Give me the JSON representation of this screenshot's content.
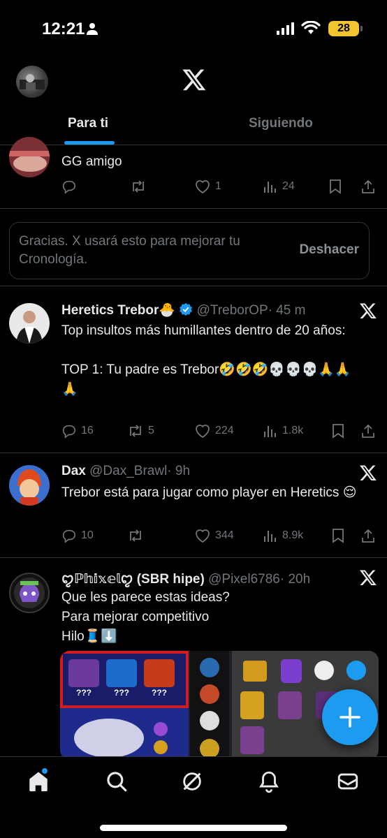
{
  "status_bar": {
    "time": "12:21",
    "battery": "28"
  },
  "header": {
    "logo": "x-logo",
    "tabs": [
      {
        "label": "Para ti",
        "active": true
      },
      {
        "label": "Siguiendo",
        "active": false
      }
    ]
  },
  "feed": {
    "reply_post": {
      "text": "GG amigo",
      "likes": "1",
      "views": "24"
    },
    "feedback": {
      "message": "Gracias. X usará esto para mejorar tu Cronología.",
      "undo_label": "Deshacer"
    },
    "posts": [
      {
        "name": "Heretics Trebor🐣",
        "handle": "@TreborOP",
        "time": "· 45 m",
        "text": "Top insultos más humillantes dentro de 20 años:\n\nTOP 1: Tu padre es Trebor🤣🤣🤣💀💀💀🙏🙏🙏",
        "replies": "16",
        "reposts": "5",
        "likes": "224",
        "views": "1.8k"
      },
      {
        "name": "Dax",
        "handle": "@Dax_Brawl",
        "time": "· 9h",
        "text": "Trebor está para jugar como player en Heretics 😌",
        "replies": "10",
        "reposts": "",
        "likes": "344",
        "views": "8.9k"
      },
      {
        "name": "ꨄ︎ℙ𝕙𝕚𝕩𝕖𝕝ꨄ︎ (SBR hipe)",
        "handle": "@Pixel6786",
        "time": "· 20h",
        "text": "Que les parece estas ideas?\nPara mejorar competitivo\nHilo🧵⬇️",
        "media_labels": [
          "???",
          "???",
          "???",
          "???",
          "???"
        ]
      }
    ]
  },
  "colors": {
    "accent": "#1d9bf0",
    "muted": "#71767b",
    "text": "#e7e9ea",
    "divider": "#2f3336"
  },
  "icons": [
    "person-icon",
    "signal-icon",
    "wifi-icon",
    "x-logo-icon",
    "reply-icon",
    "repost-icon",
    "like-icon",
    "views-icon",
    "bookmark-icon",
    "share-icon",
    "close-icon",
    "verified-icon",
    "home-icon",
    "search-icon",
    "grok-icon",
    "notifications-icon",
    "messages-icon",
    "compose-icon"
  ]
}
